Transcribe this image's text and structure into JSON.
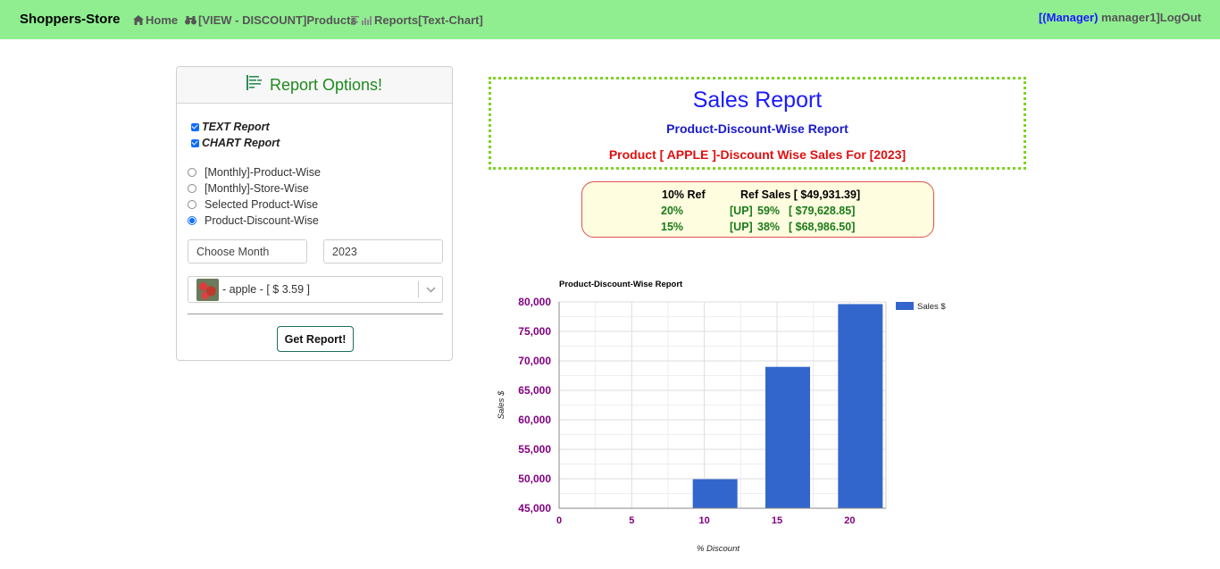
{
  "navbar": {
    "brand": "Shoppers-Store",
    "links": [
      {
        "label": "Home",
        "icon": "home-icon"
      },
      {
        "label": "[VIEW - DISCOUNT]Products",
        "icon": "binoculars-icon"
      },
      {
        "label": "Reports[Text-Chart]",
        "icon": "report-chart-icon"
      }
    ],
    "role": "[(Manager)",
    "user": "manager1]",
    "logout": "LogOut",
    "bg_color": "#90ee90"
  },
  "options": {
    "title": "Report Options!",
    "checkboxes": [
      {
        "label": "TEXT Report",
        "checked": true
      },
      {
        "label": "CHART Report",
        "checked": true
      }
    ],
    "radios": [
      {
        "label": "[Monthly]-Product-Wise",
        "selected": false
      },
      {
        "label": "[Monthly]-Store-Wise",
        "selected": false
      },
      {
        "label": "Selected Product-Wise",
        "selected": false
      },
      {
        "label": "Product-Discount-Wise",
        "selected": true
      }
    ],
    "month_placeholder": "Choose Month",
    "year_value": "2023",
    "product_select": "- apple - [ $ 3.59 ]",
    "submit_label": "Get Report!"
  },
  "report": {
    "title": "Sales Report",
    "subtitle": "Product-Discount-Wise Report",
    "product_line": "Product [ APPLE ]-Discount Wise Sales For [2023]"
  },
  "ref": {
    "header_pct": "10% Ref",
    "header_sales": "Ref Sales [ $49,931.39]",
    "rows": [
      {
        "pct": "20%",
        "trend": "[UP]",
        "change": "59%",
        "sales": "[ $79,628.85]"
      },
      {
        "pct": "15%",
        "trend": "[UP]",
        "change": "38%",
        "sales": "[ $68,986.50]"
      }
    ]
  },
  "chart_data": {
    "type": "bar",
    "title": "Product-Discount-Wise Report",
    "xlabel": "% Discount",
    "ylabel": "Sales $",
    "x": [
      10,
      15,
      20
    ],
    "series": [
      {
        "name": "Sales $",
        "values": [
          49931.39,
          68986.5,
          79628.85
        ],
        "color": "#3366cc"
      }
    ],
    "xlim": [
      0,
      22.5
    ],
    "xticks": [
      0,
      5,
      10,
      15,
      20
    ],
    "ylim": [
      45000,
      80000
    ],
    "yticks": [
      45000,
      50000,
      55000,
      60000,
      65000,
      70000,
      75000,
      80000
    ],
    "ytick_labels": [
      "45,000",
      "50,000",
      "55,000",
      "60,000",
      "65,000",
      "70,000",
      "75,000",
      "80,000"
    ],
    "grid": true,
    "legend": "right",
    "tick_label_color": "#800080"
  }
}
